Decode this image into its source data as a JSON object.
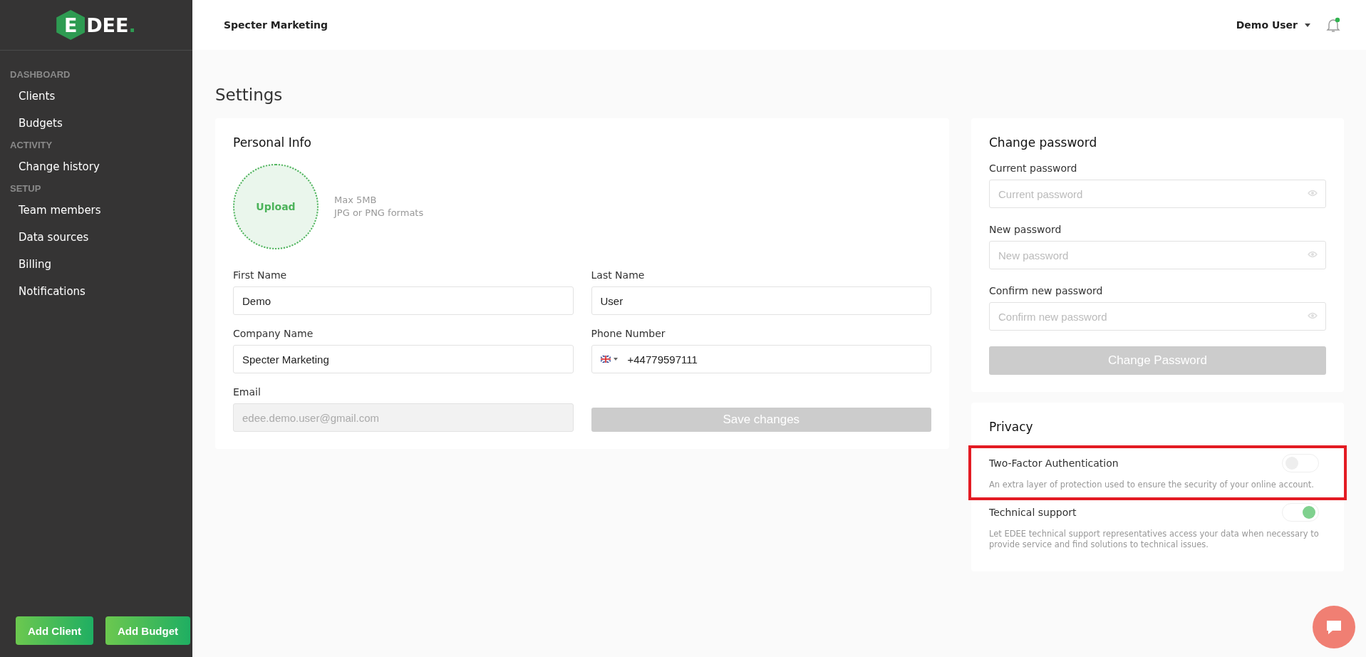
{
  "sidebar": {
    "logo": {
      "mark": "E",
      "text": "DEE",
      "dot": "."
    },
    "sections": [
      {
        "heading": "DASHBOARD",
        "items": [
          "Clients",
          "Budgets"
        ]
      },
      {
        "heading": "ACTIVITY",
        "items": [
          "Change history"
        ]
      },
      {
        "heading": "SETUP",
        "items": [
          "Team members",
          "Data sources",
          "Billing",
          "Notifications"
        ]
      }
    ],
    "buttons": [
      "Add Client",
      "Add Budget"
    ]
  },
  "header": {
    "company": "Specter Marketing",
    "user": "Demo User",
    "has_unread": true
  },
  "page_title": "Settings",
  "personal_info": {
    "title": "Personal Info",
    "upload": {
      "label": "Upload",
      "hints": [
        "Max 5MB",
        "JPG or PNG formats"
      ]
    },
    "fields": [
      {
        "label": "First Name",
        "value": "Demo",
        "kind": "text",
        "disabled": false
      },
      {
        "label": "Last Name",
        "value": "User",
        "kind": "text",
        "disabled": false
      },
      {
        "label": "Company Name",
        "value": "Specter Marketing",
        "kind": "text",
        "disabled": false
      },
      {
        "label": "Phone Number",
        "value": "+44779597111",
        "kind": "phone",
        "disabled": false
      },
      {
        "label": "Email",
        "value": "edee.demo.user@gmail.com",
        "kind": "text",
        "disabled": true
      }
    ],
    "save_button": {
      "label": "Save changes",
      "disabled": true
    }
  },
  "change_password": {
    "title": "Change password",
    "fields": [
      {
        "label": "Current password",
        "placeholder": "Current password"
      },
      {
        "label": "New password",
        "placeholder": "New password"
      },
      {
        "label": "Confirm new password",
        "placeholder": "Confirm new password"
      }
    ],
    "button": {
      "label": "Change Password",
      "disabled": true
    }
  },
  "privacy": {
    "title": "Privacy",
    "settings": [
      {
        "label": "Two-Factor Authentication",
        "description": "An extra layer of protection used to ensure the security of your online account.",
        "on": false,
        "highlighted": true
      },
      {
        "label": "Technical support",
        "description": "Let EDEE technical support representatives access your data when necessary to provide service and find solutions to technical issues.",
        "on": true,
        "highlighted": false
      }
    ]
  }
}
